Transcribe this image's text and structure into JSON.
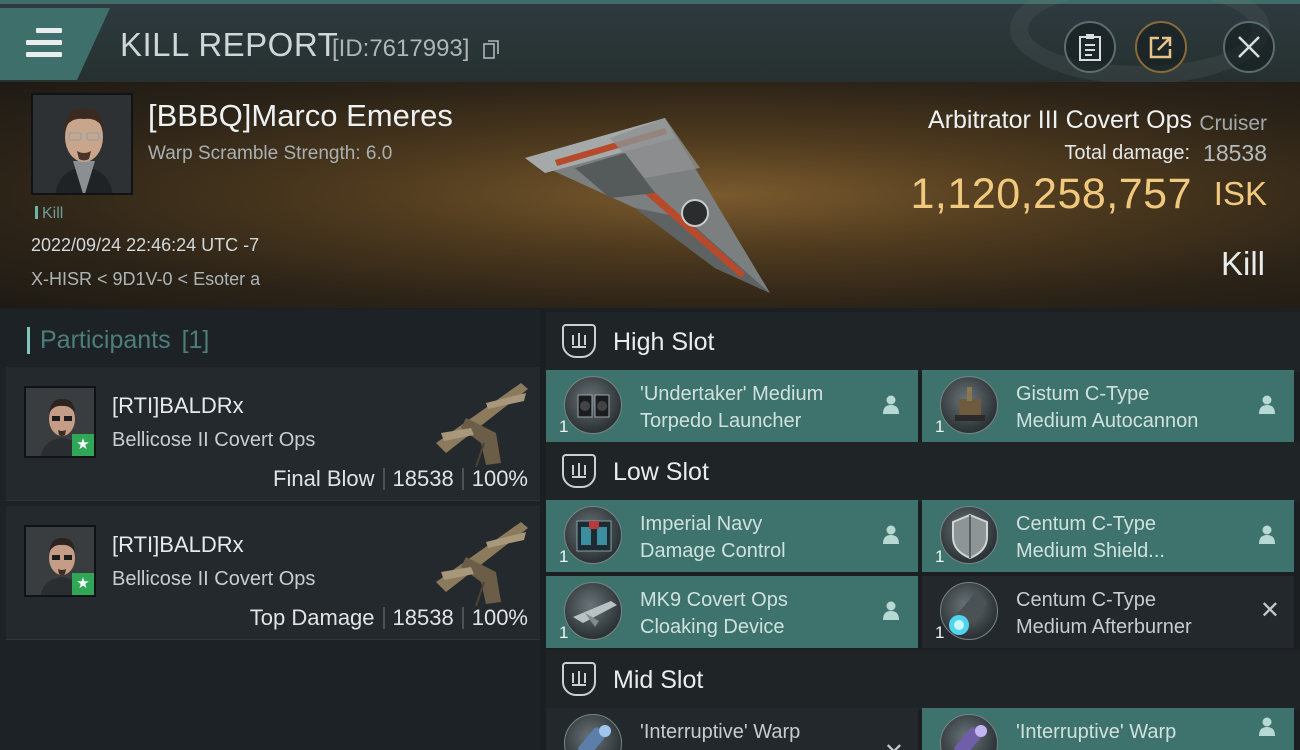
{
  "header": {
    "title": "KILL REPORT",
    "report_id": "[ID:7617993]",
    "icons": [
      "menu-icon",
      "copy-icon",
      "clipboard-icon",
      "share-icon",
      "close-icon"
    ]
  },
  "victim": {
    "name": "[BBBQ]Marco Emeres",
    "scramble": "Warp Scramble Strength: 6.0",
    "tag": "Kill",
    "datetime": "2022/09/24 22:46:24 UTC -7",
    "location": "X-HISR < 9D1V-0 < Esoter a",
    "ship": "Arbitrator III Covert Ops",
    "ship_class": "Cruiser",
    "damage_label": "Total damage:",
    "damage_value": "18538",
    "isk_value": "1,120,258,757",
    "isk_unit": "ISK",
    "result": "Kill"
  },
  "participants": {
    "title": "Participants",
    "count": "[1]",
    "items": [
      {
        "name": "[RTI]BALDRx",
        "ship": "Bellicose II Covert Ops",
        "role": "Final Blow",
        "damage": "18538",
        "percent": "100%"
      },
      {
        "name": "[RTI]BALDRx",
        "ship": "Bellicose II Covert Ops",
        "role": "Top Damage",
        "damage": "18538",
        "percent": "100%"
      }
    ]
  },
  "fitting": {
    "high": {
      "title": "High Slot",
      "modules": [
        {
          "name1": "'Undertaker' Medium",
          "name2": "Torpedo Launcher",
          "qty": "1",
          "status": "person-icon"
        },
        {
          "name1": "Gistum C-Type",
          "name2": "Medium Autocannon",
          "qty": "1",
          "status": "person-icon"
        }
      ]
    },
    "low": {
      "title": "Low Slot",
      "modules": [
        {
          "name1": "Imperial Navy",
          "name2": "Damage Control",
          "qty": "1",
          "status": "person-icon"
        },
        {
          "name1": "Centum C-Type",
          "name2": "Medium Shield...",
          "qty": "1",
          "status": "person-icon"
        },
        {
          "name1": "MK9 Covert Ops",
          "name2": "Cloaking Device",
          "qty": "1",
          "status": "person-icon"
        },
        {
          "name1": "Centum C-Type",
          "name2": "Medium Afterburner",
          "qty": "1",
          "status": "destroyed-x-icon"
        }
      ]
    },
    "mid": {
      "title": "Mid Slot",
      "modules": [
        {
          "name1": "'Interruptive' Warp",
          "name2": "",
          "qty": "",
          "status": "destroyed-x-icon"
        },
        {
          "name1": "'Interruptive' Warp",
          "name2": "",
          "qty": "",
          "status": "person-icon"
        }
      ]
    }
  },
  "colors": {
    "accent_teal": "#3e726c",
    "isk_gold": "#f0c97e",
    "badge_green": "#2fa756"
  }
}
